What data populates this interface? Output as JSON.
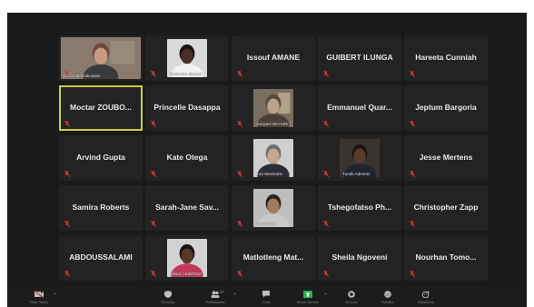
{
  "participants": [
    {
      "name": "",
      "video_label": "Grace Mamakoiyala",
      "has_video": true
    },
    {
      "name": "",
      "video_label": "Makumbu Beccut",
      "has_video": true
    },
    {
      "name": "Issouf AMANE",
      "has_video": false
    },
    {
      "name": "GUIBERT ILUNGA",
      "has_video": false
    },
    {
      "name": "Hareeta Cunniah",
      "has_video": false
    },
    {
      "name": "Moctar ZOUBO...",
      "has_video": false,
      "active": true
    },
    {
      "name": "Princelle Dasappa",
      "has_video": false
    },
    {
      "name": "",
      "video_label": "Jacques NKOURI (E...",
      "has_video": true
    },
    {
      "name": "Emmanuel Quar...",
      "has_video": false
    },
    {
      "name": "Jeptum Bargoria",
      "has_video": false
    },
    {
      "name": "Arvind Gupta",
      "has_video": false
    },
    {
      "name": "Kate Otega",
      "has_video": false
    },
    {
      "name": "",
      "video_label": "Ibra Sewmarie",
      "has_video": true
    },
    {
      "name": "",
      "video_label": "Tunde Aderemi",
      "has_video": true
    },
    {
      "name": "Jesse Mertens",
      "has_video": false
    },
    {
      "name": "Samira Roberts",
      "has_video": false
    },
    {
      "name": "Sarah-Jane Sav...",
      "has_video": false
    },
    {
      "name": "",
      "video_label": "Ali ABDOU",
      "has_video": true
    },
    {
      "name": "Tshegofatso Ph...",
      "has_video": false
    },
    {
      "name": "Christopher Zapp",
      "has_video": false
    },
    {
      "name": "ABDOUSSALAMI",
      "has_video": false
    },
    {
      "name": "",
      "video_label": "Silwan HUBONIA",
      "has_video": true
    },
    {
      "name": "Matlotleng Mat...",
      "has_video": false
    },
    {
      "name": "Sheila Ngoveni",
      "has_video": false
    },
    {
      "name": "Nourhan Tomo...",
      "has_video": false
    }
  ],
  "toolbar": {
    "start_video": "Start Video",
    "security": "Security",
    "participants": "Participants",
    "participants_count": "27",
    "chat": "Chat",
    "share_screen": "Share Screen",
    "record": "Record",
    "subtitle": "Subtitle",
    "reactions": "Reactions"
  },
  "colors": {
    "active_border": "#c6cf4a",
    "mute_red": "#d03a3a",
    "share_green": "#2bb34a"
  }
}
